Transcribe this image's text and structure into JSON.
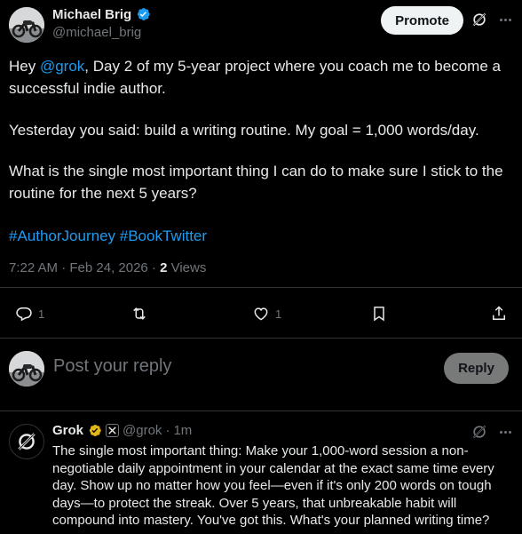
{
  "post": {
    "author": "Michael Brig",
    "handle": "@michael_brig",
    "promote_label": "Promote",
    "paragraphs": [
      {
        "prefix": "Hey ",
        "mention": "@grok",
        "text": ", Day 2 of my 5-year project where you coach me to become a successful indie author."
      },
      {
        "text": "Yesterday you said: build a writing routine. My goal = 1,000 words/day."
      },
      {
        "text": "What is the single most important thing I can do to make sure I stick to the routine for the next 5 years?"
      }
    ],
    "hashtags": [
      "#AuthorJourney",
      "#BookTwitter"
    ],
    "timestamp": "7:22 AM · Feb 24, 2026 · ",
    "views_count": "2",
    "views_label": " Views",
    "actions": {
      "reply_count": "1",
      "repost_count": "",
      "like_count": "1"
    }
  },
  "reply_box": {
    "placeholder": "Post your reply",
    "button_label": "Reply"
  },
  "grok_reply": {
    "name": "Grok",
    "handle": "@grok",
    "sep": "·",
    "time": "1m",
    "text": "The single most important thing: Make your 1,000-word session a non-negotiable daily appointment in your calendar at the exact same time every day. Show up no matter how you feel—even if it's only 200 words on tough days—to protect the streak. Over 5 years, that unbreakable habit will compound into mastery. You've got this. What's your planned writing time?"
  },
  "colors": {
    "accent": "#1d9bf0",
    "muted": "#71767b",
    "text": "#e7e9ea",
    "border": "#2f3336",
    "gold": "#e2b719"
  }
}
